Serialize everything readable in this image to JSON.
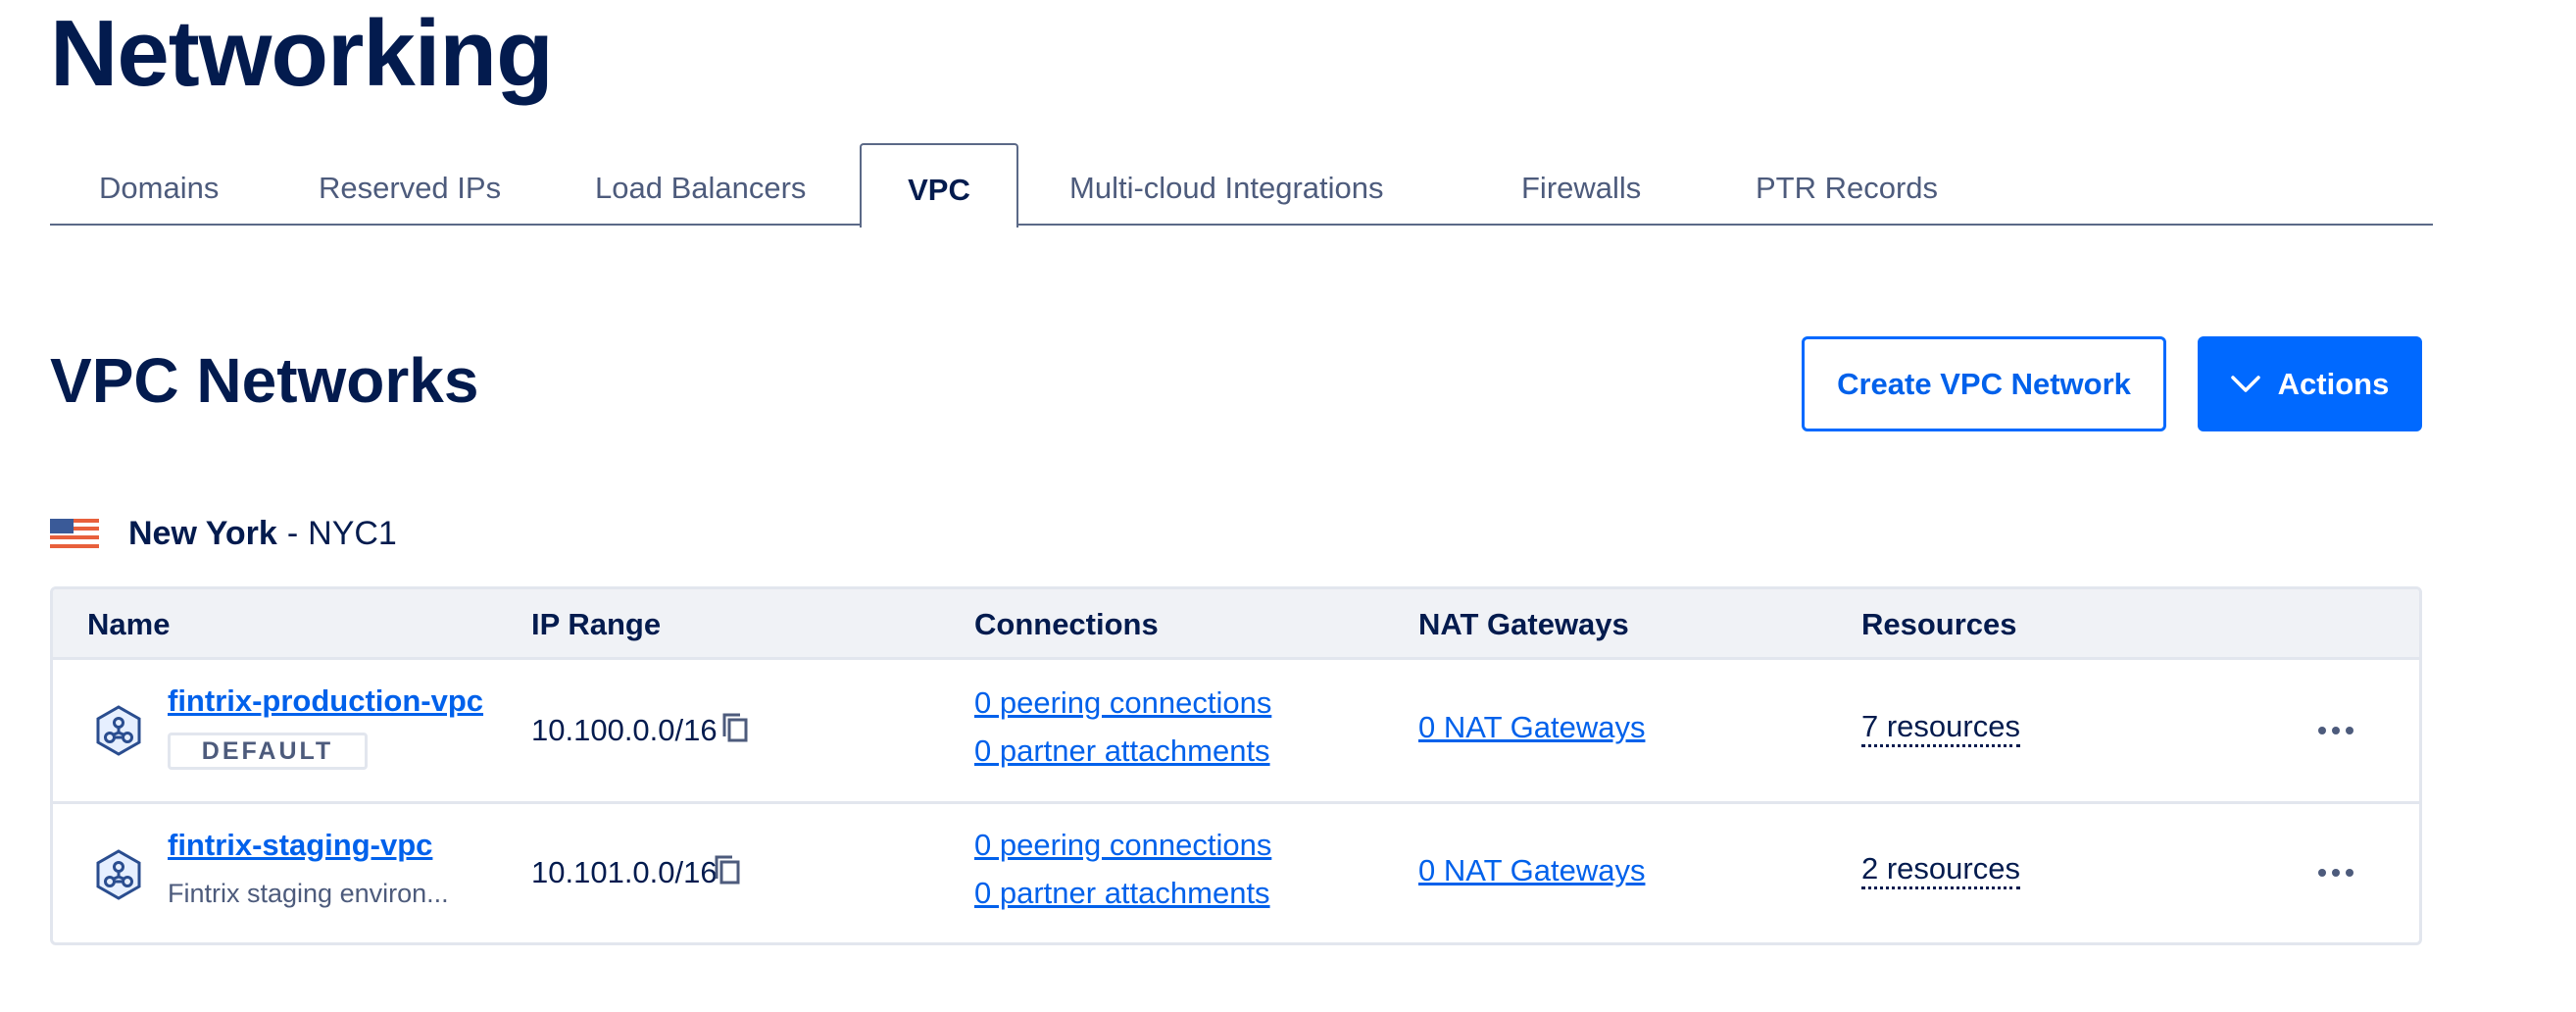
{
  "page": {
    "title": "Networking"
  },
  "tabs": [
    {
      "label": "Domains"
    },
    {
      "label": "Reserved IPs"
    },
    {
      "label": "Load Balancers"
    },
    {
      "label": "VPC",
      "active": true
    },
    {
      "label": "Multi-cloud Integrations"
    },
    {
      "label": "Firewalls"
    },
    {
      "label": "PTR Records"
    }
  ],
  "section": {
    "title": "VPC Networks",
    "create_label": "Create VPC Network",
    "actions_label": "Actions"
  },
  "region": {
    "name": "New York",
    "separator": "-",
    "code": "NYC1"
  },
  "table": {
    "headers": [
      "Name",
      "IP Range",
      "Connections",
      "NAT Gateways",
      "Resources"
    ],
    "rows": [
      {
        "name": "fintrix-production-vpc",
        "badge": "DEFAULT",
        "ip_range": "10.100.0.0/16",
        "peering": "0 peering connections",
        "partner": "0 partner attachments",
        "nat": "0 NAT Gateways",
        "resources": "7 resources"
      },
      {
        "name": "fintrix-staging-vpc",
        "description": "Fintrix staging environ...",
        "ip_range": "10.101.0.0/16",
        "peering": "0 peering connections",
        "partner": "0 partner attachments",
        "nat": "0 NAT Gateways",
        "resources": "2 resources"
      }
    ]
  },
  "icons": {
    "vpc": "vpc-network-icon",
    "copy": "copy-icon",
    "more": "more-options-icon",
    "chevron": "chevron-down-icon",
    "flag": "us-flag-icon"
  },
  "colors": {
    "brand": "#0069ff",
    "text": "#031b4e",
    "muted": "#4d5b7c",
    "border": "#e2e6ee",
    "header_bg": "#f0f2f6"
  }
}
